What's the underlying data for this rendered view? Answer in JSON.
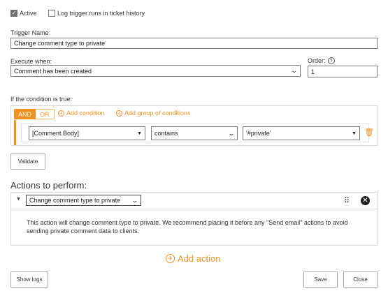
{
  "header": {
    "active_label": "Active",
    "active_checked": true,
    "log_label": "Log trigger runs in ticket history",
    "log_checked": false
  },
  "trigger": {
    "name_label": "Trigger Name:",
    "name_value": "Change comment type to private",
    "execute_label": "Execute when:",
    "execute_value": "Comment has been created",
    "order_label": "Order:",
    "order_value": "1"
  },
  "conditions": {
    "title": "If the condition is true:",
    "and_label": "AND",
    "or_label": "OR",
    "add_condition_label": "Add condition",
    "add_group_label": "Add group of conditions",
    "rows": [
      {
        "field": "[Comment.Body]",
        "operator": "contains",
        "value": "'#private'"
      }
    ],
    "validate_label": "Validate"
  },
  "actions": {
    "title": "Actions to perform:",
    "items": [
      {
        "type": "Change comment type to private",
        "description": "This action will change comment type to private. We recommend placing it before any \"Send email\" actions to avoid sending private comment data to clients."
      }
    ],
    "add_action_label": "Add action"
  },
  "footer": {
    "show_logs_label": "Show logs",
    "save_label": "Save",
    "close_label": "Close"
  },
  "colors": {
    "accent": "#f0901e",
    "border": "#d6d6d6"
  }
}
